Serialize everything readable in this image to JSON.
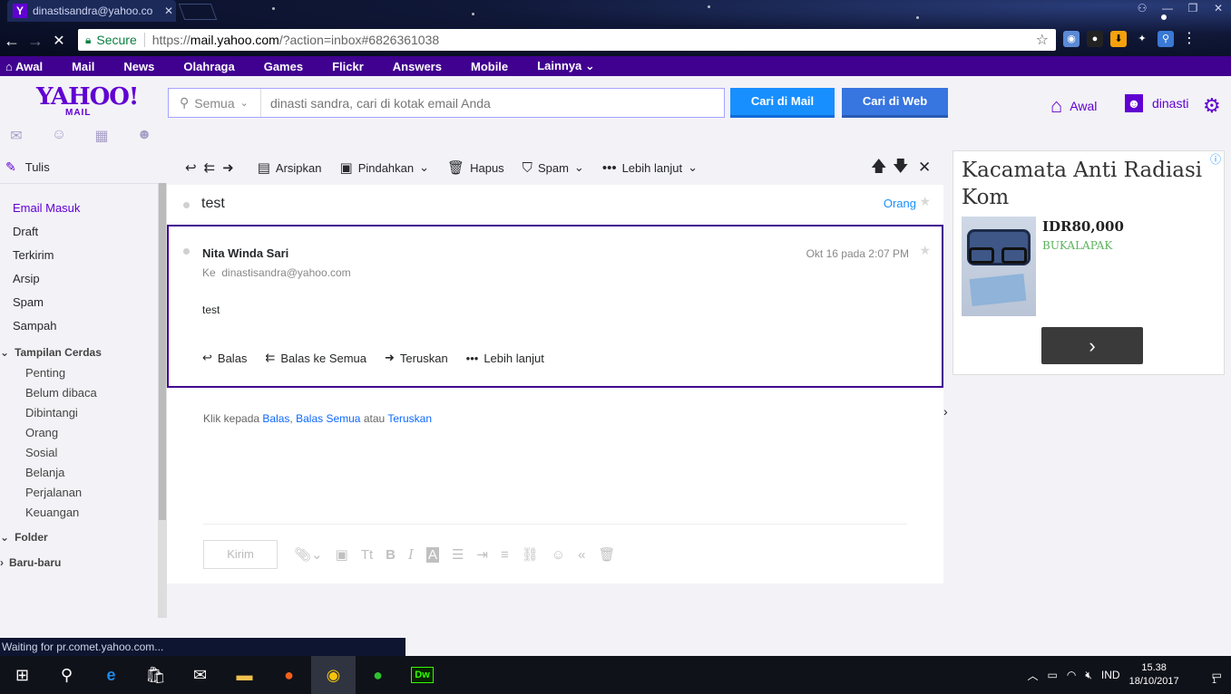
{
  "browser": {
    "tab_title": "dinastisandra@yahoo.co",
    "tab_favicon": "Y",
    "secure_label": "Secure",
    "url_scheme": "https://",
    "url_host": "mail.yahoo.com",
    "url_path": "/?action=inbox#6826361038",
    "status_text": "Waiting for pr.comet.yahoo.com..."
  },
  "yahoo_nav": [
    "Awal",
    "Mail",
    "News",
    "Olahraga",
    "Games",
    "Flickr",
    "Answers",
    "Mobile",
    "Lainnya"
  ],
  "header": {
    "logo": "YAHOO!",
    "logo_sub": "MAIL",
    "search_scope": "Semua",
    "search_placeholder": "dinasti sandra, cari di kotak email Anda",
    "btn_mail": "Cari di Mail",
    "btn_web": "Cari di Web",
    "home_label": "Awal",
    "user_label": "dinasti"
  },
  "sidebar": {
    "compose": "Tulis",
    "folders": [
      "Email Masuk",
      "Draft",
      "Terkirim",
      "Arsip",
      "Spam",
      "Sampah"
    ],
    "smart_views_title": "Tampilan Cerdas",
    "smart_views": [
      "Penting",
      "Belum dibaca",
      "Dibintangi",
      "Orang",
      "Sosial",
      "Belanja",
      "Perjalanan",
      "Keuangan"
    ],
    "folder_section": "Folder",
    "recent_section": "Baru-baru"
  },
  "toolbar": {
    "archive": "Arsipkan",
    "move": "Pindahkan",
    "delete": "Hapus",
    "spam": "Spam",
    "more": "Lebih lanjut"
  },
  "message": {
    "subject": "test",
    "people_link": "Orang",
    "sender": "Nita Winda Sari",
    "to_prefix": "Ke",
    "to_address": "dinastisandra@yahoo.com",
    "date": "Okt 16 pada 2:07 PM",
    "body": "test",
    "actions": [
      "Balas",
      "Balas ke Semua",
      "Teruskan",
      "Lebih lanjut"
    ]
  },
  "reply_hint": {
    "prefix": "Klik kepada",
    "link1": "Balas",
    "comma": ",",
    "link2": "Balas Semua",
    "middle": "atau",
    "link3": "Teruskan"
  },
  "composer": {
    "send": "Kirim"
  },
  "ad": {
    "title": "Kacamata Anti Radiasi Kom",
    "price": "IDR80,000",
    "source": "BUKALAPAK"
  },
  "taskbar": {
    "lang": "IND",
    "time": "15.38",
    "date": "18/10/2017",
    "notifications": "1"
  }
}
